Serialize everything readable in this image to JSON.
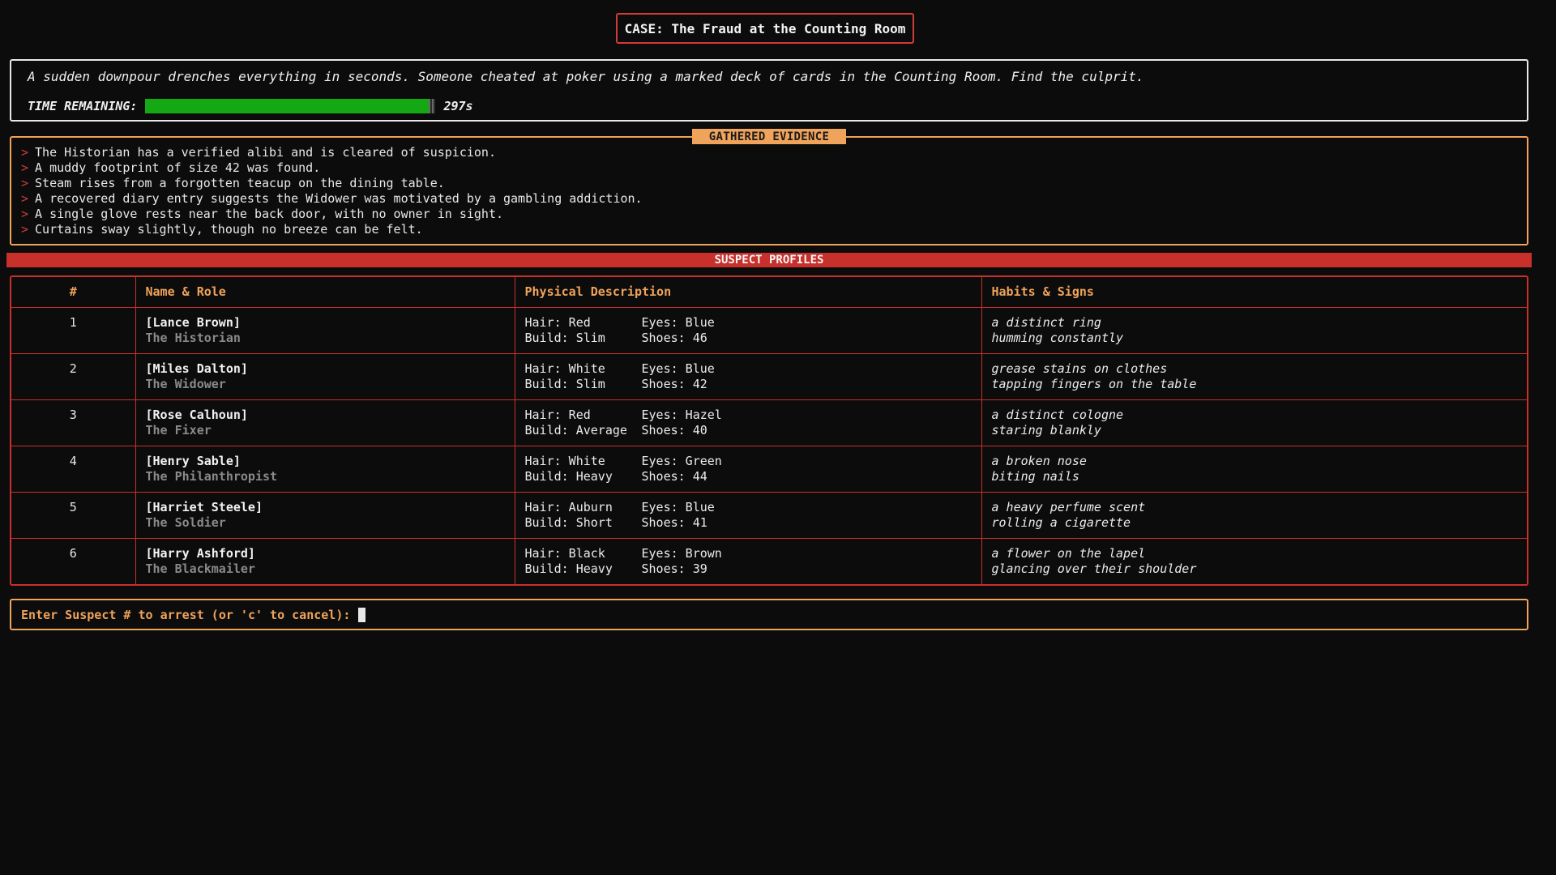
{
  "case": {
    "title": "CASE: The Fraud at the Counting Room"
  },
  "intro": {
    "text": "A sudden downpour drenches everything in seconds. Someone cheated at poker using a marked deck of cards in the Counting Room. Find the culprit.",
    "time_label": "TIME REMAINING:",
    "time_value": "297s",
    "time_fraction": 0.98
  },
  "evidence": {
    "header": "GATHERED EVIDENCE",
    "prompt_glyph": ">",
    "items": [
      "The Historian has a verified alibi and is cleared of suspicion.",
      "A muddy footprint of size 42 was found.",
      "Steam rises from a forgotten teacup on the dining table.",
      "A recovered diary entry suggests the Widower was motivated by a gambling addiction.",
      "A single glove rests near the back door, with no owner in sight.",
      "Curtains sway slightly, though no breeze can be felt."
    ]
  },
  "suspects": {
    "banner": "SUSPECT PROFILES",
    "columns": [
      "#",
      "Name & Role",
      "Physical Description",
      "Habits & Signs"
    ],
    "rows": [
      {
        "num": "1",
        "name": "[Lance Brown]",
        "role": "The Historian",
        "hair": "Hair: Red",
        "eyes": "Eyes: Blue",
        "build": "Build: Slim",
        "shoes": "Shoes: 46",
        "habit1": "a distinct ring",
        "habit2": "humming constantly"
      },
      {
        "num": "2",
        "name": "[Miles Dalton]",
        "role": "The Widower",
        "hair": "Hair: White",
        "eyes": "Eyes: Blue",
        "build": "Build: Slim",
        "shoes": "Shoes: 42",
        "habit1": "grease stains on clothes",
        "habit2": "tapping fingers on the table"
      },
      {
        "num": "3",
        "name": "[Rose Calhoun]",
        "role": "The Fixer",
        "hair": "Hair: Red",
        "eyes": "Eyes: Hazel",
        "build": "Build: Average",
        "shoes": "Shoes: 40",
        "habit1": "a distinct cologne",
        "habit2": "staring blankly"
      },
      {
        "num": "4",
        "name": "[Henry Sable]",
        "role": "The Philanthropist",
        "hair": "Hair: White",
        "eyes": "Eyes: Green",
        "build": "Build: Heavy",
        "shoes": "Shoes: 44",
        "habit1": "a broken nose",
        "habit2": "biting nails"
      },
      {
        "num": "5",
        "name": "[Harriet Steele]",
        "role": "The Soldier",
        "hair": "Hair: Auburn",
        "eyes": "Eyes: Blue",
        "build": "Build: Short",
        "shoes": "Shoes: 41",
        "habit1": "a heavy perfume scent",
        "habit2": "rolling a cigarette"
      },
      {
        "num": "6",
        "name": "[Harry Ashford]",
        "role": "The Blackmailer",
        "hair": "Hair: Black",
        "eyes": "Eyes: Brown",
        "build": "Build: Heavy",
        "shoes": "Shoes: 39",
        "habit1": "a flower on the lapel",
        "habit2": "glancing over their shoulder"
      }
    ]
  },
  "input": {
    "prompt": "Enter Suspect # to arrest (or 'c' to cancel):"
  },
  "colors": {
    "accent_red": "#c8302c",
    "accent_orange": "#f0a35a",
    "timer_green": "#14a814"
  }
}
